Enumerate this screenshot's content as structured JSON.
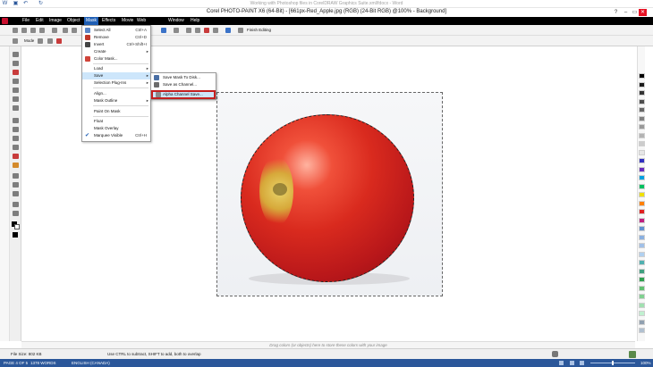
{
  "word": {
    "title": "Working with Photoshop files in CorelDRAW Graphics Suite.xml/fdocx - Word",
    "status": {
      "page": "PAGE 4 OF 5",
      "words": "1378 WORDS",
      "language": "ENGLISH (CANADA)",
      "zoom": "100%"
    }
  },
  "corel": {
    "title": "Corel PHOTO-PAINT X6 (64-Bit) - [661px-Red_Apple.jpg (RGB) (24-Bit RGB) @100% - Background]"
  },
  "menubar": [
    "File",
    "Edit",
    "Image",
    "Object",
    "Mask",
    "Effects",
    "Movie",
    "Web",
    "Window",
    "Help"
  ],
  "toolbar": {
    "finish_editing": "Finish Editing",
    "mode_label": "Mode"
  },
  "mask_menu": {
    "items": [
      {
        "label": "Select All",
        "shortcut": "Ctrl+A"
      },
      {
        "label": "Remove",
        "shortcut": "Ctrl+D"
      },
      {
        "label": "Invert",
        "shortcut": "Ctrl+Shift+I"
      },
      {
        "label": "Create",
        "shortcut": ""
      },
      {
        "label": "Color Mask...",
        "shortcut": ""
      },
      {
        "label": "Load",
        "shortcut": ""
      },
      {
        "label": "Save",
        "shortcut": ""
      },
      {
        "label": "Selection Plug-Ins",
        "shortcut": ""
      },
      {
        "label": "Align...",
        "shortcut": ""
      },
      {
        "label": "Mask Outline",
        "shortcut": ""
      },
      {
        "label": "Paint On Mask",
        "shortcut": ""
      },
      {
        "label": "Float",
        "shortcut": ""
      },
      {
        "label": "Mask Overlay",
        "shortcut": ""
      },
      {
        "label": "Marquee Visible",
        "shortcut": "Ctrl+H"
      }
    ]
  },
  "save_submenu": {
    "items": [
      {
        "label": "Save Mask To Disk..."
      },
      {
        "label": "Save as Channel..."
      },
      {
        "label": "Alpha Channel Save..."
      }
    ]
  },
  "statusbar": {
    "file_size": "File Size: 802 KB",
    "hint": "Use CTRL to subtract, SHIFT to add, both to overlap"
  },
  "workspace": {
    "drag_hint": "Drag colors (or objects) here to store these colors with your image"
  },
  "colors": {
    "menubar_bg": "#000000",
    "accent": "#1f5fb5",
    "word_blue": "#2b579a",
    "highlight_red": "#c41e1e"
  },
  "palette": [
    "#000000",
    "#1a1a1a",
    "#333333",
    "#4d4d4d",
    "#666666",
    "#808080",
    "#999999",
    "#b3b3b3",
    "#cccccc",
    "#e6e6e6",
    "#3030c0",
    "#6a2dbd",
    "#00a0e0",
    "#00c060",
    "#f0e000",
    "#ff8000",
    "#e02020",
    "#c02080",
    "#6090d0",
    "#8ab0e0",
    "#a0c0e8",
    "#b0d0f0",
    "#50b0b0",
    "#40a080",
    "#30a050",
    "#60c070",
    "#80d090",
    "#a0e0b0",
    "#c0f0d0",
    "#90a0b0",
    "#b0c0d0"
  ]
}
